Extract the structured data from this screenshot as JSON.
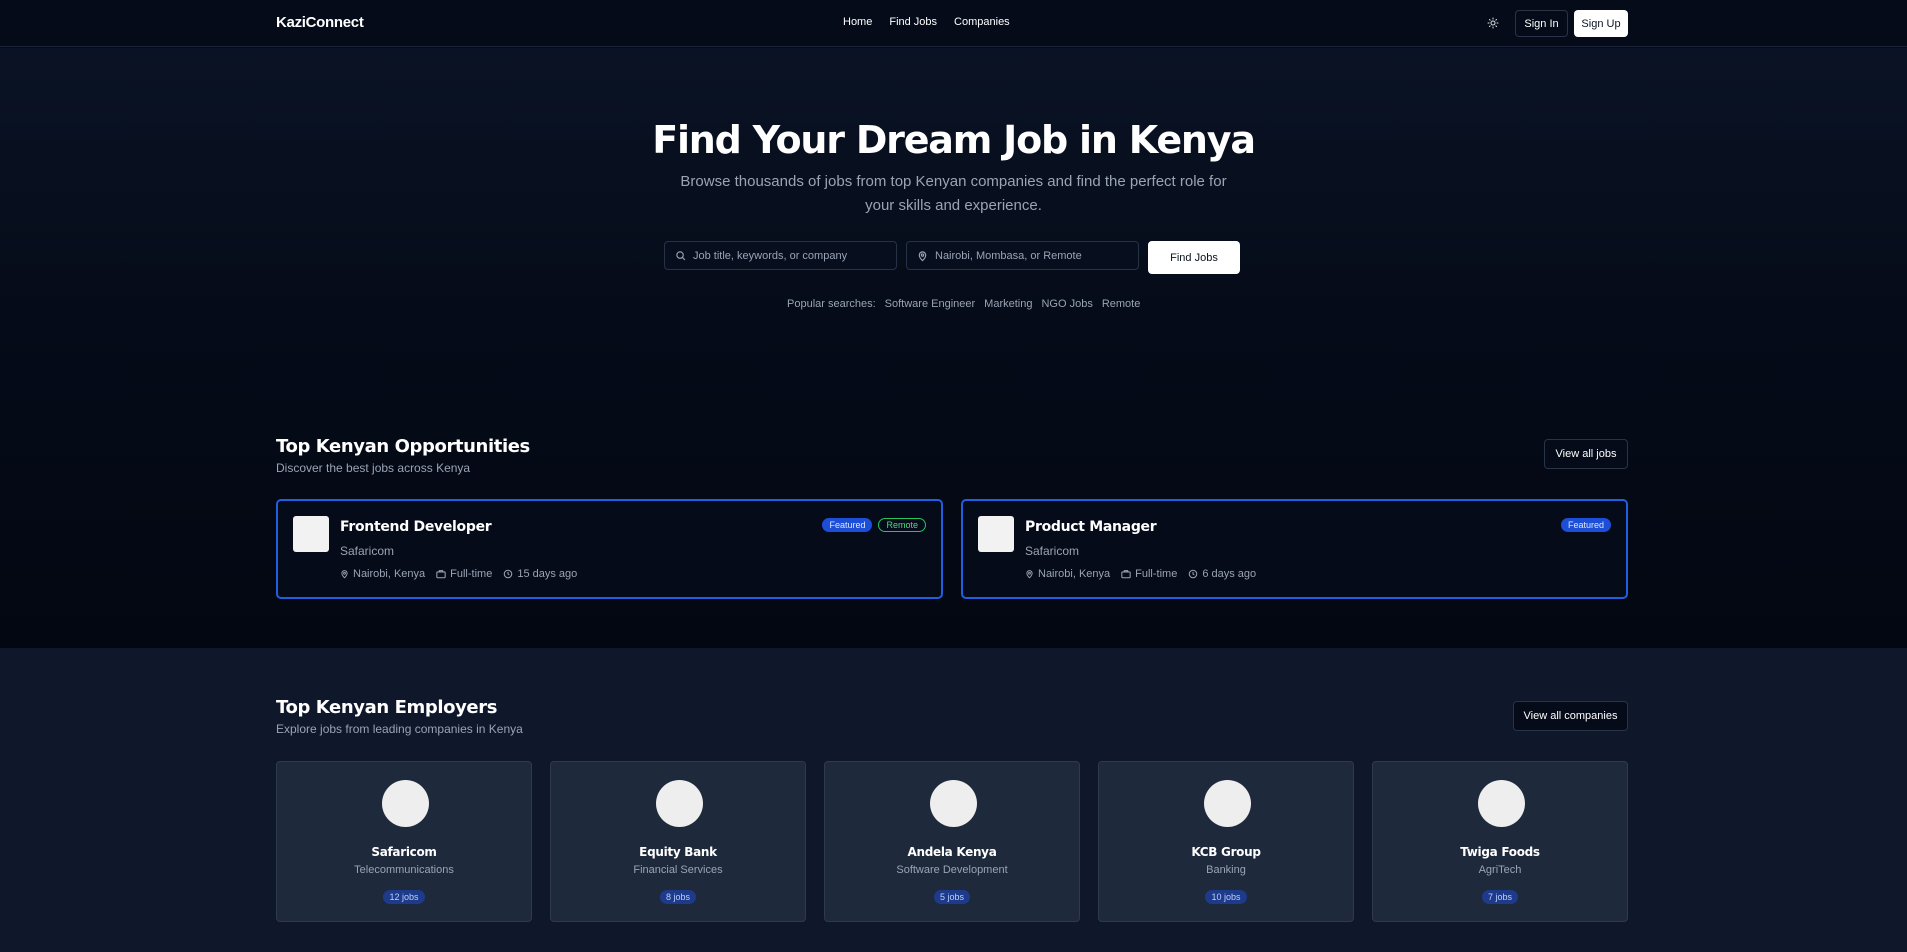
{
  "nav": {
    "brand": "KaziConnect",
    "links": [
      "Home",
      "Find Jobs",
      "Companies"
    ],
    "sign_in": "Sign In",
    "sign_up": "Sign Up"
  },
  "hero": {
    "title": "Find Your Dream Job in Kenya",
    "subtitle": "Browse thousands of jobs from top Kenyan companies and find the perfect role for your skills and experience.",
    "search_placeholder": "Job title, keywords, or company",
    "location_placeholder": "Nairobi, Mombasa, or Remote",
    "find_button": "Find Jobs",
    "popular_label": "Popular searches:",
    "popular_tags": [
      "Software Engineer",
      "Marketing",
      "NGO Jobs",
      "Remote"
    ]
  },
  "jobs_section": {
    "title": "Top Kenyan Opportunities",
    "subtitle": "Discover the best jobs across Kenya",
    "view_all": "View all jobs",
    "jobs": [
      {
        "title": "Frontend Developer",
        "company": "Safaricom",
        "location": "Nairobi, Kenya",
        "type": "Full-time",
        "posted": "15 days ago",
        "featured": "Featured",
        "remote": "Remote"
      },
      {
        "title": "Product Manager",
        "company": "Safaricom",
        "location": "Nairobi, Kenya",
        "type": "Full-time",
        "posted": "6 days ago",
        "featured": "Featured"
      }
    ]
  },
  "employers_section": {
    "title": "Top Kenyan Employers",
    "subtitle": "Explore jobs from leading companies in Kenya",
    "view_all": "View all companies",
    "employers": [
      {
        "name": "Safaricom",
        "industry": "Telecommunications",
        "jobs": "12 jobs"
      },
      {
        "name": "Equity Bank",
        "industry": "Financial Services",
        "jobs": "8 jobs"
      },
      {
        "name": "Andela Kenya",
        "industry": "Software Development",
        "jobs": "5 jobs"
      },
      {
        "name": "KCB Group",
        "industry": "Banking",
        "jobs": "10 jobs"
      },
      {
        "name": "Twiga Foods",
        "industry": "AgriTech",
        "jobs": "7 jobs"
      }
    ]
  },
  "colors": {
    "background": "#050b18",
    "accent": "#1f5fe0",
    "remote_badge": "#22c55e"
  },
  "icons": {
    "theme": "sun-icon",
    "search": "search-icon",
    "location": "map-pin-icon",
    "job_type": "briefcase-icon",
    "posted": "clock-icon"
  }
}
